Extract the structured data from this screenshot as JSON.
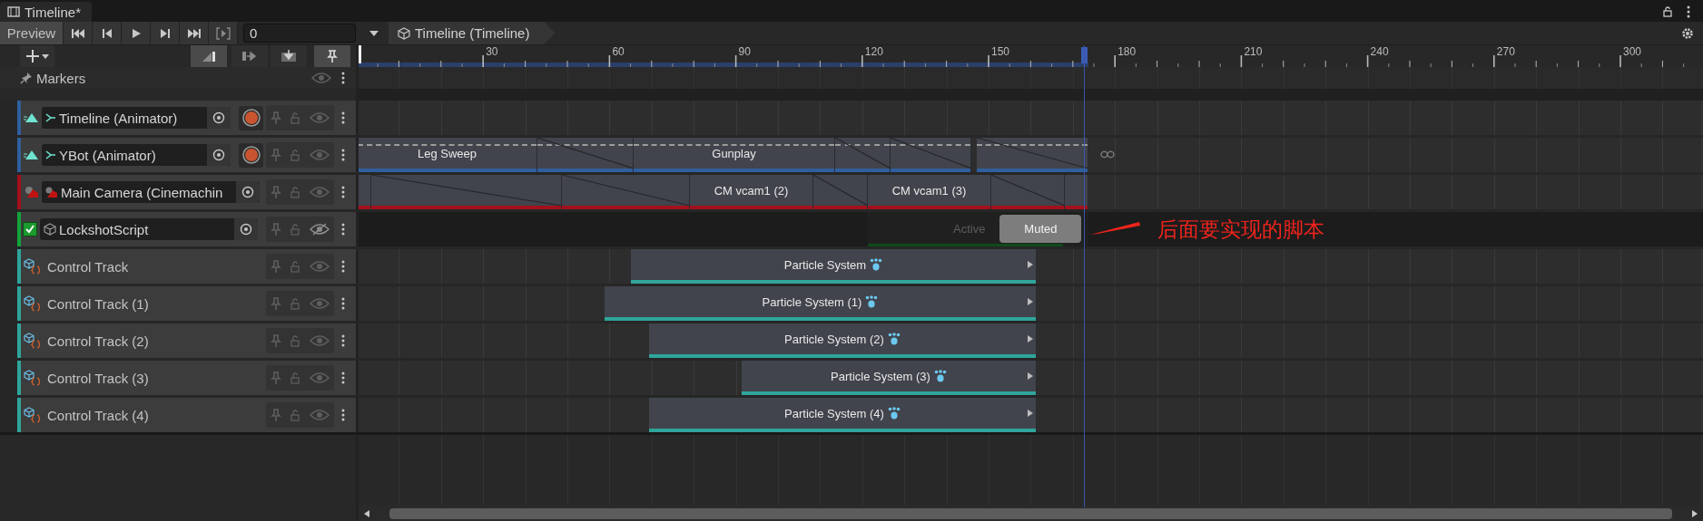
{
  "tab": {
    "title": "Timeline*"
  },
  "toolbar": {
    "preview": "Preview",
    "frame": "0",
    "breadcrumb": "Timeline (Timeline)"
  },
  "edit_modes": [
    {
      "selected": true
    },
    {
      "selected": false
    },
    {
      "selected": false
    }
  ],
  "snap": {
    "on": true
  },
  "ruler": {
    "labels": [
      "30",
      "60",
      "90",
      "120",
      "150",
      "180",
      "210",
      "240",
      "270",
      "300"
    ]
  },
  "markers": {
    "label": "Markers"
  },
  "tracks": [
    {
      "kind": "animation",
      "name": "Timeline (Animator)",
      "color": "#2f5f9e",
      "muted": false
    },
    {
      "kind": "animation",
      "name": "YBot (Animator)",
      "color": "#2f5f9e",
      "muted": false,
      "clips": [
        {
          "kind": "clip",
          "label": "Leg Sweep"
        },
        {
          "kind": "blend"
        },
        {
          "kind": "clip",
          "label": "Gunplay"
        },
        {
          "kind": "blend"
        },
        {
          "kind": "blend"
        },
        {
          "kind": "blend"
        }
      ]
    },
    {
      "kind": "camera",
      "name": "Main Camera (Cinemachin",
      "color": "#a3101b",
      "muted": false,
      "clips": [
        {
          "kind": "clip"
        },
        {
          "kind": "blend"
        },
        {
          "kind": "blend"
        },
        {
          "kind": "clip",
          "label": "CM vcam1 (2)"
        },
        {
          "kind": "blend"
        },
        {
          "kind": "clip",
          "label": "CM vcam1 (3)"
        },
        {
          "kind": "blend"
        },
        {
          "kind": "clip"
        }
      ]
    },
    {
      "kind": "script",
      "name": "LockshotScript",
      "color": "#13a43a",
      "checked": true,
      "muted": true,
      "states": [
        {
          "label": "Active",
          "selected": false
        },
        {
          "label": "Muted",
          "selected": true
        }
      ]
    },
    {
      "kind": "control",
      "name": "Control Track",
      "color": "#2fa59b",
      "muted": false,
      "clips": [
        {
          "kind": "clip",
          "label": "Particle System"
        }
      ]
    },
    {
      "kind": "control",
      "name": "Control Track (1)",
      "color": "#2fa59b",
      "muted": false,
      "clips": [
        {
          "kind": "clip",
          "label": "Particle System (1)"
        }
      ]
    },
    {
      "kind": "control",
      "name": "Control Track (2)",
      "color": "#2fa59b",
      "muted": false,
      "clips": [
        {
          "kind": "clip",
          "label": "Particle System (2)"
        }
      ]
    },
    {
      "kind": "control",
      "name": "Control Track (3)",
      "color": "#2fa59b",
      "muted": false,
      "clips": [
        {
          "kind": "clip",
          "label": "Particle System (3)"
        }
      ]
    },
    {
      "kind": "control",
      "name": "Control Track (4)",
      "color": "#2fa59b",
      "muted": false,
      "clips": [
        {
          "kind": "clip",
          "label": "Particle System (4)"
        }
      ]
    }
  ],
  "annotation": {
    "text": "后面要实现的脚本"
  }
}
